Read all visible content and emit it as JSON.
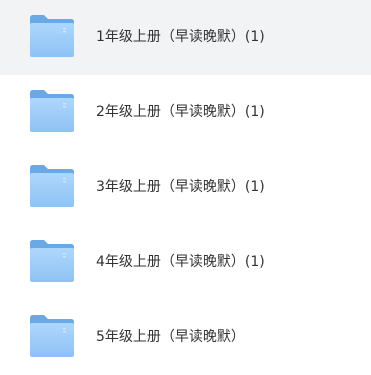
{
  "folders": [
    {
      "name": "1年级上册（早读晚默）(1)",
      "selected": true
    },
    {
      "name": "2年级上册（早读晚默）(1)",
      "selected": false
    },
    {
      "name": "3年级上册（早读晚默）(1)",
      "selected": false
    },
    {
      "name": "4年级上册（早读晚默）(1)",
      "selected": false
    },
    {
      "name": "5年级上册（早读晚默）",
      "selected": false
    }
  ],
  "colors": {
    "selected_row_bg": "#f1f3f5",
    "folder_back": "#6aa9e6",
    "folder_front_top": "#a9d4fb",
    "folder_front_bottom": "#88bdf2",
    "text": "#333333"
  }
}
